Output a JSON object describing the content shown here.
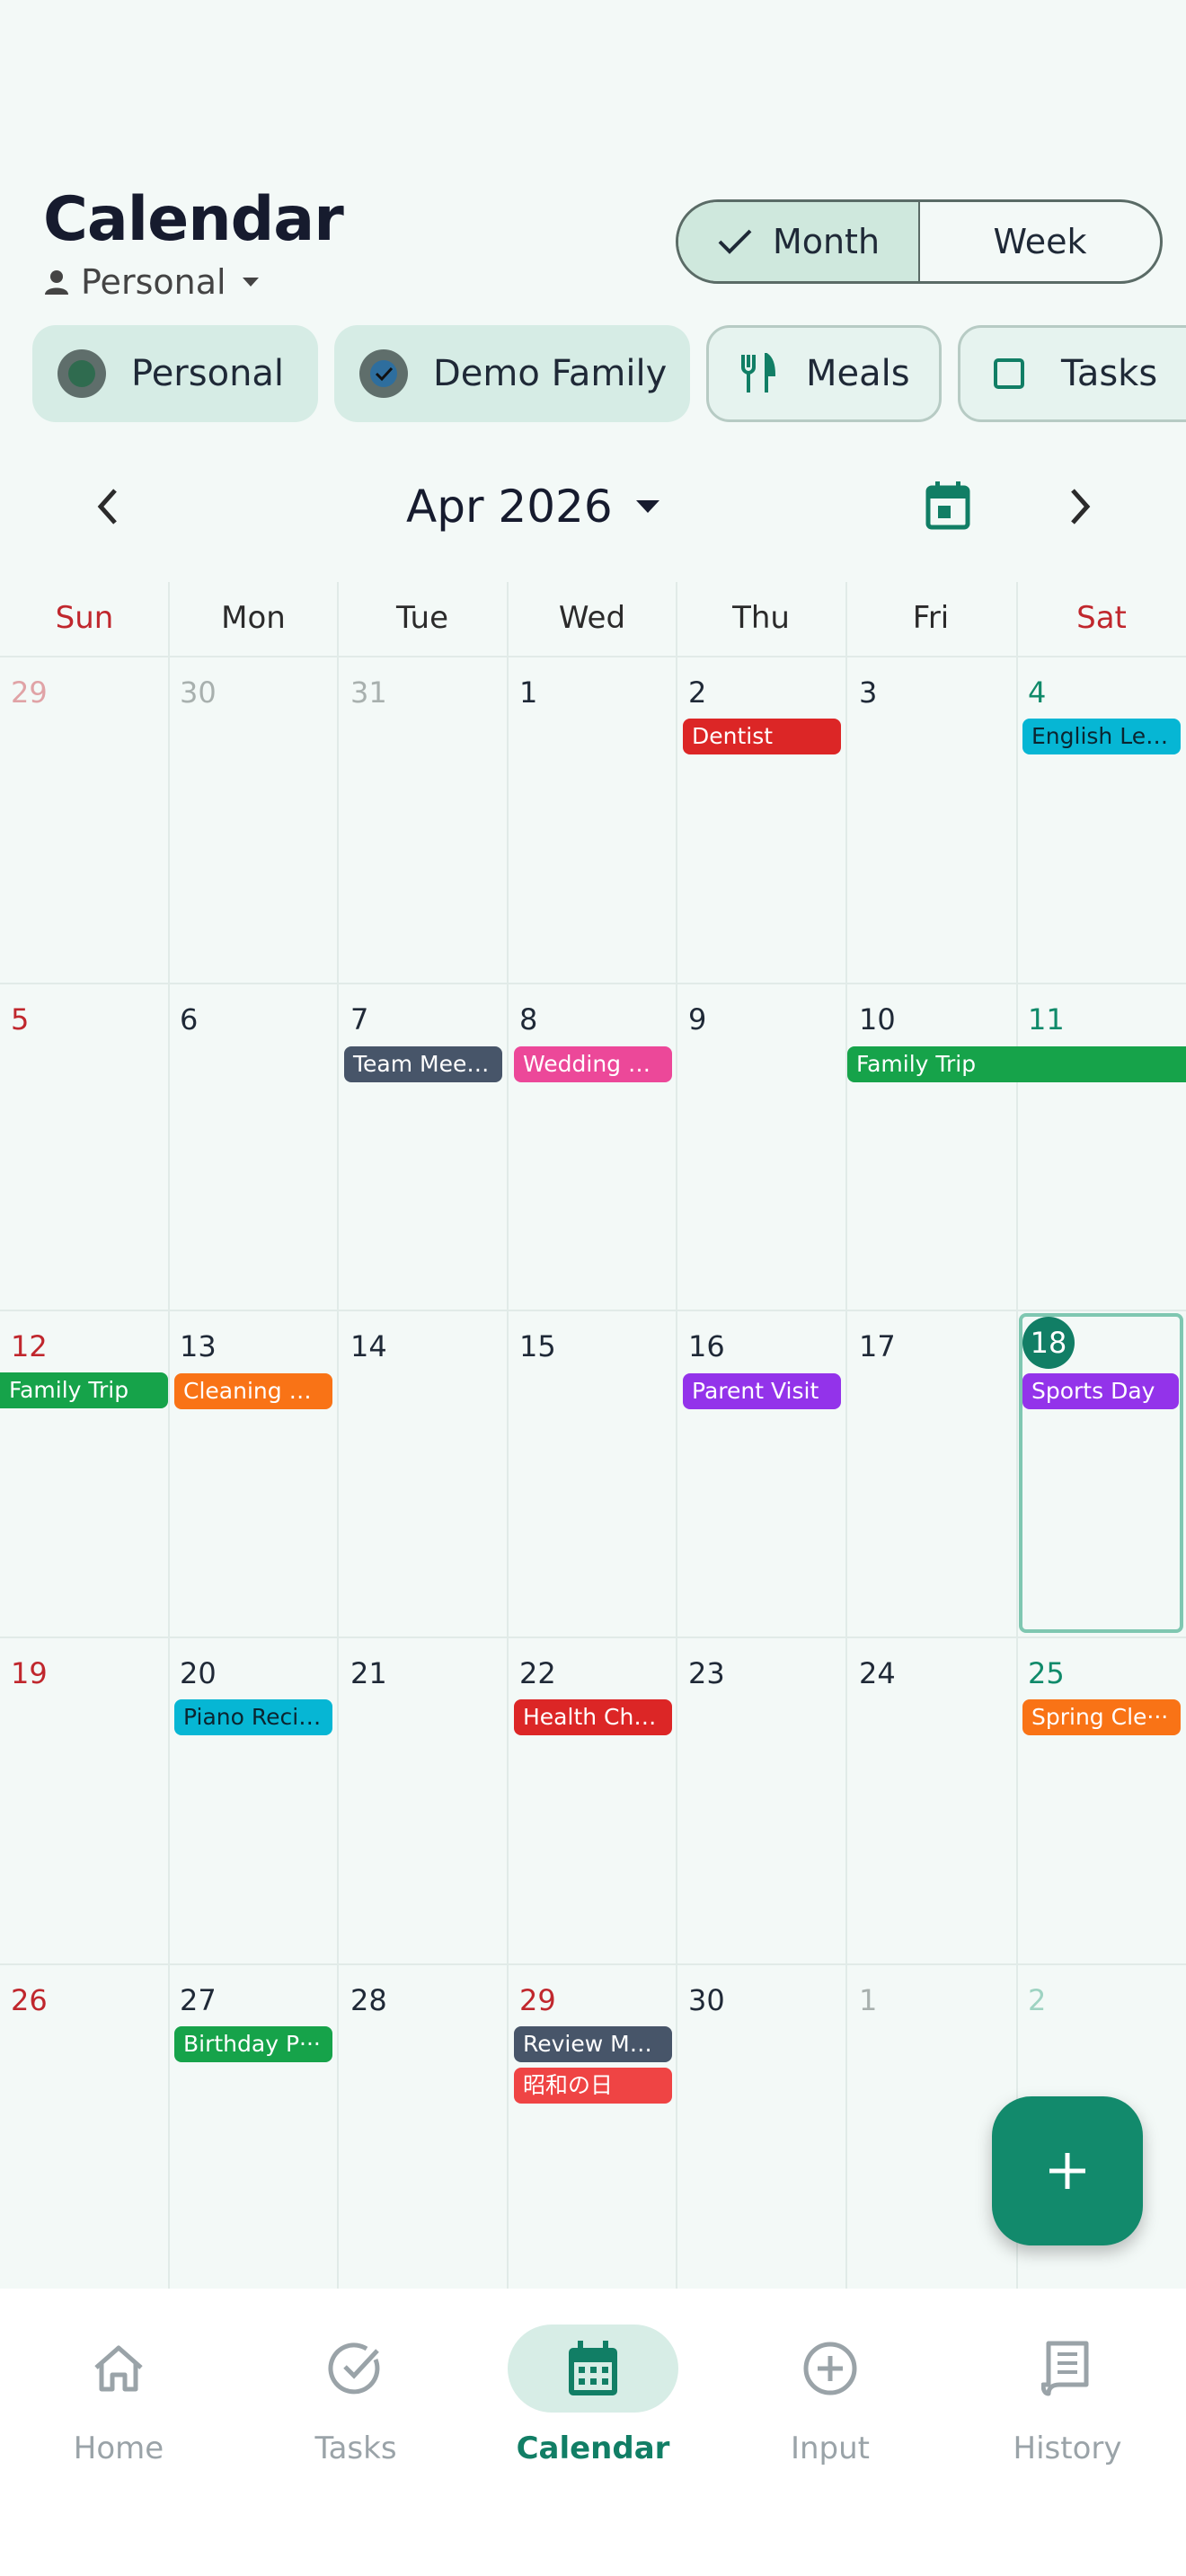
{
  "header": {
    "title": "Calendar",
    "account": "Personal"
  },
  "view_toggle": {
    "options": [
      "Month",
      "Week"
    ],
    "selected": "Month"
  },
  "filters": [
    {
      "label": "Personal",
      "checked": true,
      "color": "#2f6b4f"
    },
    {
      "label": "Demo Family",
      "checked": true,
      "color": "#2e6e9e"
    },
    {
      "label": "Meals",
      "icon": "fork-knife-icon",
      "checked": false
    },
    {
      "label": "Tasks",
      "icon": "checkbox-icon",
      "checked": false
    }
  ],
  "nav": {
    "month_label": "Apr 2026"
  },
  "weekdays": [
    "Sun",
    "Mon",
    "Tue",
    "Wed",
    "Thu",
    "Fri",
    "Sat"
  ],
  "weeks": [
    [
      "29",
      "30",
      "31",
      "1",
      "2",
      "3",
      "4"
    ],
    [
      "5",
      "6",
      "7",
      "8",
      "9",
      "10",
      "11"
    ],
    [
      "12",
      "13",
      "14",
      "15",
      "16",
      "17",
      "18"
    ],
    [
      "19",
      "20",
      "21",
      "22",
      "23",
      "24",
      "25"
    ],
    [
      "26",
      "27",
      "28",
      "29",
      "30",
      "1",
      "2"
    ]
  ],
  "today": "18",
  "events": {
    "dentist": "Dentist",
    "english": "English Les···",
    "team": "Team Meet···",
    "wedding": "Wedding A···",
    "family_trip": "Family Trip",
    "family_trip_cont": "Family Trip",
    "cleaning": "Cleaning Day",
    "parent": "Parent Visit",
    "sports": "Sports Day",
    "piano": "Piano Recital",
    "health": "Health Che···",
    "spring": "Spring Cle···",
    "birthday": "Birthday P···",
    "review": "Review Me···",
    "showa": "昭和の日"
  },
  "event_colors": {
    "red": "#dc2626",
    "cyan": "#06b6d4",
    "slate": "#475569",
    "pink": "#ec4899",
    "green": "#16a34a",
    "orange": "#f97316",
    "purple": "#9333ea",
    "red_light": "#ef4444"
  },
  "bottom_nav": [
    {
      "label": "Home",
      "icon": "home-icon"
    },
    {
      "label": "Tasks",
      "icon": "task-check-icon"
    },
    {
      "label": "Calendar",
      "icon": "calendar-icon",
      "active": true
    },
    {
      "label": "Input",
      "icon": "add-circle-icon"
    },
    {
      "label": "History",
      "icon": "receipt-icon"
    }
  ],
  "accent": "#117e65"
}
